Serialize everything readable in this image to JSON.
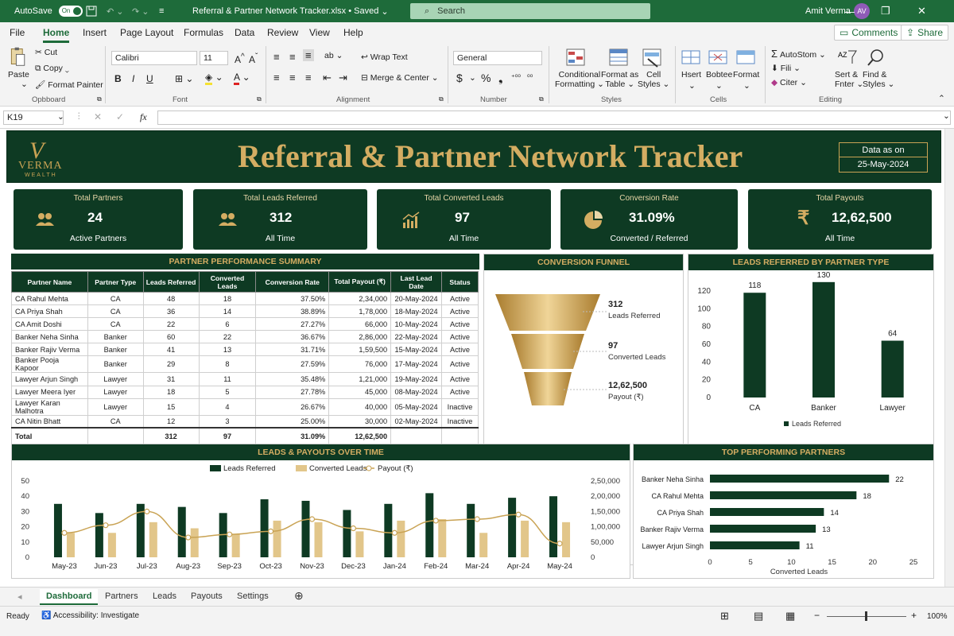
{
  "titlebar": {
    "autosave": "AutoSave",
    "toggle": "On",
    "doc": "Referral & Partner Network Tracker.xlsx",
    "saved": "Saved",
    "search": "Search",
    "user": "Amit Verma",
    "initials": "AV"
  },
  "menu": {
    "file": "File",
    "home": "Home",
    "insert": "Insert",
    "page_layout": "Page Layout",
    "formulas": "Formulas",
    "data": "Data",
    "review": "Review",
    "view": "View",
    "help": "Help",
    "comments": "Comments",
    "share": "Share"
  },
  "ribbon": {
    "paste": "Paste",
    "cut": "Cut",
    "copy": "Copy",
    "format_painter": "Format Painter",
    "clipboard": "Opbboard",
    "font_name": "Calibri",
    "font_size": "11",
    "font": "Font",
    "wrap": "Wrap Text",
    "merge": "Merge & Center",
    "alignment": "Alignment",
    "number_format": "General",
    "number": "Number",
    "cond1": "Conditional",
    "cond2": "Formatting",
    "fmt_table1": "Format as",
    "fmt_table2": "Table",
    "cell1": "Cell",
    "cell2": "Styles",
    "styles": "Styles",
    "insert": "Hsert",
    "delete": "Bobtee",
    "format": "Format",
    "cells": "Cells",
    "autosum": "AutoStom",
    "fill": "Fili",
    "clear": "Citer",
    "sort1": "Sert &",
    "sort2": "Fnter",
    "find1": "Find &",
    "find2": "Styles",
    "editing": "Editing"
  },
  "formula": {
    "namebox": "K19",
    "fx": "fx"
  },
  "header": {
    "logo_mark": "V",
    "logo_text": "VERMA",
    "logo_sub": "WEALTH",
    "title": "Referral & Partner Network Tracker",
    "date_label": "Data as on",
    "date_value": "25-May-2024"
  },
  "kpis": [
    {
      "title": "Total Partners",
      "value": "24",
      "sub": "Active Partners",
      "icon": "people-icon"
    },
    {
      "title": "Total Leads Referred",
      "value": "312",
      "sub": "All Time",
      "icon": "people-icon"
    },
    {
      "title": "Total Converted Leads",
      "value": "97",
      "sub": "All Time",
      "icon": "trend-chart-icon"
    },
    {
      "title": "Conversion Rate",
      "value": "31.09%",
      "sub": "Converted / Referred",
      "icon": "pie-chart-icon"
    },
    {
      "title": "Total Payouts",
      "value": "12,62,500",
      "sub": "All Time",
      "icon": "rupee-icon"
    }
  ],
  "summary": {
    "title": "PARTNER PERFORMANCE SUMMARY",
    "columns": [
      "Partner Name",
      "Partner Type",
      "Leads Referred",
      "Converted Leads",
      "Conversion Rate",
      "Total Payout (₹)",
      "Last Lead Date",
      "Status"
    ],
    "rows": [
      [
        "CA Rahul Mehta",
        "CA",
        "48",
        "18",
        "37.50%",
        "2,34,000",
        "20-May-2024",
        "Active"
      ],
      [
        "CA Priya Shah",
        "CA",
        "36",
        "14",
        "38.89%",
        "1,78,000",
        "18-May-2024",
        "Active"
      ],
      [
        "CA Amit Doshi",
        "CA",
        "22",
        "6",
        "27.27%",
        "66,000",
        "10-May-2024",
        "Active"
      ],
      [
        "Banker Neha Sinha",
        "Banker",
        "60",
        "22",
        "36.67%",
        "2,86,000",
        "22-May-2024",
        "Active"
      ],
      [
        "Banker Rajiv Verma",
        "Banker",
        "41",
        "13",
        "31.71%",
        "1,59,500",
        "15-May-2024",
        "Active"
      ],
      [
        "Banker Pooja Kapoor",
        "Banker",
        "29",
        "8",
        "27.59%",
        "76,000",
        "17-May-2024",
        "Active"
      ],
      [
        "Lawyer Arjun Singh",
        "Lawyer",
        "31",
        "11",
        "35.48%",
        "1,21,000",
        "19-May-2024",
        "Active"
      ],
      [
        "Lawyer Meera Iyer",
        "Lawyer",
        "18",
        "5",
        "27.78%",
        "45,000",
        "08-May-2024",
        "Active"
      ],
      [
        "Lawyer Karan Malhotra",
        "Lawyer",
        "15",
        "4",
        "26.67%",
        "40,000",
        "05-May-2024",
        "Inactive"
      ],
      [
        "CA Nitin Bhatt",
        "CA",
        "12",
        "3",
        "25.00%",
        "30,000",
        "02-May-2024",
        "Inactive"
      ]
    ],
    "total": [
      "Total",
      "",
      "312",
      "97",
      "31.09%",
      "12,62,500",
      "",
      ""
    ]
  },
  "funnel": {
    "title": "CONVERSION FUNNEL",
    "stages": [
      {
        "value": "312",
        "label": "Leads Referred"
      },
      {
        "value": "97",
        "label": "Converted Leads"
      },
      {
        "value": "12,62,500",
        "label": "Payout (₹)"
      }
    ]
  },
  "colors": {
    "dark_green": "#0e3a23",
    "gold": "#d4ad62",
    "light_gold": "#e2c68a",
    "excel_green": "#1e6b3a"
  },
  "chart_data": [
    {
      "type": "bar",
      "title": "LEADS REFERRED BY PARTNER TYPE",
      "categories": [
        "CA",
        "Banker",
        "Lawyer"
      ],
      "values": [
        118,
        130,
        64
      ],
      "ylim": [
        0,
        120
      ],
      "yticks": [
        "0",
        "20",
        "40",
        "60",
        "80",
        "100",
        "120"
      ],
      "legend": "Leads Referred"
    },
    {
      "type": "bar+line",
      "title": "LEADS & PAYOUTS OVER TIME",
      "categories": [
        "May-23",
        "Jun-23",
        "Jul-23",
        "Aug-23",
        "Sep-23",
        "Oct-23",
        "Nov-23",
        "Dec-23",
        "Jan-24",
        "Feb-24",
        "Mar-24",
        "Apr-24",
        "May-24"
      ],
      "series": [
        {
          "name": "Leads Referred",
          "values": [
            35,
            29,
            35,
            33,
            29,
            38,
            37,
            31,
            35,
            42,
            35,
            39,
            40
          ]
        },
        {
          "name": "Converted Leads",
          "values": [
            16,
            16,
            23,
            19,
            15,
            24,
            23,
            17,
            24,
            25,
            16,
            24,
            23
          ]
        },
        {
          "name": "Payout (₹)",
          "values": [
            80000,
            105000,
            150000,
            65000,
            75000,
            85000,
            125000,
            95000,
            80000,
            120000,
            125000,
            140000,
            45000
          ]
        }
      ],
      "ylim": [
        0,
        50
      ],
      "y2lim": [
        0,
        250000
      ],
      "yticks": [
        "0",
        "10",
        "20",
        "30",
        "40",
        "50"
      ],
      "y2ticks": [
        "0",
        "50,000",
        "1,00,000",
        "1,50,000",
        "2,00,000",
        "2,50,000"
      ]
    },
    {
      "type": "hbar",
      "title": "TOP PERFORMING PARTNERS",
      "categories": [
        "Banker Neha Sinha",
        "CA Rahul Mehta",
        "CA Priya Shah",
        "Banker Rajiv Verma",
        "Lawyer Arjun Singh"
      ],
      "values": [
        22,
        18,
        14,
        13,
        11
      ],
      "xlim": [
        0,
        25
      ],
      "xticks": [
        "0",
        "5",
        "10",
        "15",
        "20",
        "25"
      ],
      "xlabel": "Converted Leads"
    }
  ],
  "tabs": [
    "Dashboard",
    "Partners",
    "Leads",
    "Payouts",
    "Settings"
  ],
  "status": {
    "ready": "Ready",
    "accessibility": "Accessibility: Investigate",
    "zoom": "100%"
  }
}
